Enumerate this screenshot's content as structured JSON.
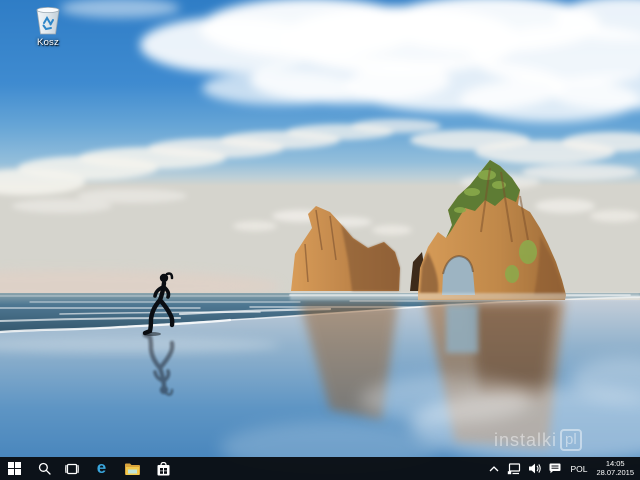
{
  "desktop": {
    "recycle_bin": {
      "label": "Kosz"
    }
  },
  "wallpaper": {
    "description": "Wharariki Beach rocks with arch, runner silhouette, reflective wet sand",
    "elements": [
      "sky",
      "clouds",
      "ocean",
      "small-rock",
      "arch-rock",
      "runner",
      "reflections",
      "wet-sand"
    ]
  },
  "watermark": {
    "name": "instalki",
    "tld": "pl"
  },
  "taskbar": {
    "buttons": [
      "start",
      "search",
      "task-view",
      "edge",
      "file-explorer",
      "store"
    ],
    "tray": {
      "icons": [
        "hidden-icons-chevron",
        "network",
        "volume",
        "action-center"
      ],
      "language": "POL",
      "time": "14:05",
      "date": "28.07.2015"
    }
  },
  "colors": {
    "taskbar_bg": "#0a0e14",
    "edge_blue": "#39a6dd",
    "folder_yellow": "#f2c94c",
    "sky_top": "#2f7dc6",
    "sky_horizon": "#d5d4cd",
    "sea_dark": "#3a607a",
    "sand_blue": "#4080ba",
    "rock_gold": "#d79c58",
    "rock_shadow": "#6b452a",
    "rock_green": "#5e7c34",
    "recycle_blue": "#2e86c8"
  }
}
